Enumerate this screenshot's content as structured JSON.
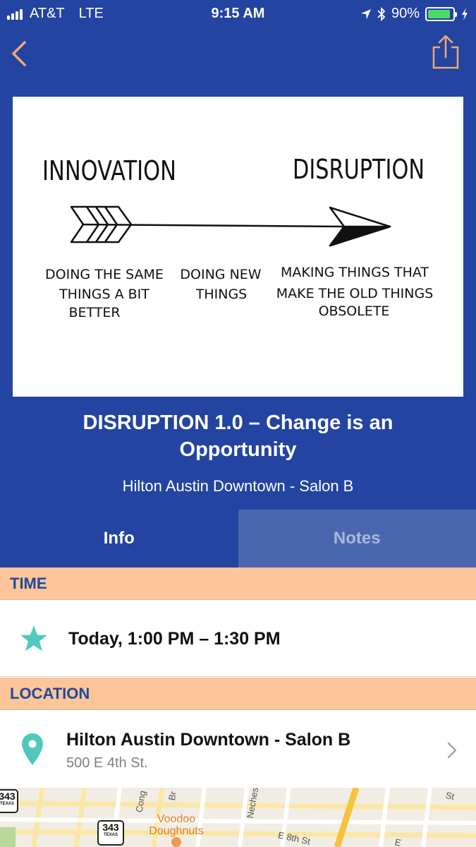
{
  "status_bar": {
    "carrier": "AT&T",
    "network": "LTE",
    "time": "9:15 AM",
    "battery_percent": "90%",
    "battery_level": 0.9,
    "battery_color": "#4cd964"
  },
  "header": {
    "back_icon": "chevron-left-icon",
    "share_icon": "share-icon",
    "title": "DISRUPTION 1.0 – Change is an Opportunity",
    "room": "Hilton Austin Downtown - Salon B"
  },
  "illustration": {
    "left_heading": "INNOVATION",
    "right_heading": "DISRUPTION",
    "caption_1_lines": [
      "DOING THE SAME",
      "THINGS A BIT",
      "BETTER"
    ],
    "caption_2_lines": [
      "DOING NEW",
      "THINGS"
    ],
    "caption_3_lines": [
      "MAKING THINGS THAT",
      "MAKE  THE OLD THINGS",
      "OBSOLETE"
    ]
  },
  "tabs": [
    {
      "label": "Info",
      "active": true
    },
    {
      "label": "Notes",
      "active": false
    }
  ],
  "time_section": {
    "header": "TIME",
    "value": "Today, 1:00 PM – 1:30 PM",
    "icon": "star-icon"
  },
  "location_section": {
    "header": "LOCATION",
    "name": "Hilton Austin Downtown - Salon B",
    "address": "500 E 4th St.",
    "icon": "location-pin-icon"
  },
  "map": {
    "route_number": "343",
    "route_state": "TEXAS",
    "poi": "Voodoo Doughnuts",
    "streets": [
      "Cong",
      "Br",
      "Neches",
      "E 8th St",
      "St",
      "E"
    ]
  },
  "colors": {
    "brand_blue": "#2344a0",
    "inactive_tab": "#4a66af",
    "section_header_bg": "#fdc59a",
    "section_header_text": "#1f4a9a",
    "accent_teal": "#4fc9be",
    "back_chevron": "#f0a875"
  }
}
